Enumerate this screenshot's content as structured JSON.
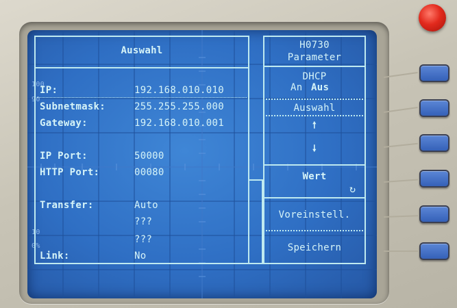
{
  "left_panel": {
    "title": "Auswahl",
    "rows": [
      {
        "label": "IP:",
        "value": "192.168.010.010"
      },
      {
        "label": "Subnetmask:",
        "value": "255.255.255.000"
      },
      {
        "label": "Gateway:",
        "value": "192.168.010.001"
      },
      {
        "label": "IP Port:",
        "value": "50000"
      },
      {
        "label": "HTTP Port:",
        "value": "00080"
      },
      {
        "label": "Transfer:",
        "value": "Auto"
      },
      {
        "label": "",
        "value": "???"
      },
      {
        "label": "",
        "value": "???"
      },
      {
        "label": "Link:",
        "value": "No"
      }
    ]
  },
  "right_panel": {
    "model": "H0730",
    "heading": "Parameter",
    "dhcp_label": "DHCP",
    "dhcp_on": "An",
    "dhcp_off": "Aus",
    "auswahl": "Auswahl",
    "up_arrow": "🠕",
    "down_arrow": "🠗",
    "wert": "Wert",
    "refresh_icon_glyph": "↻",
    "voreinstell": "Voreinstell.",
    "speichern": "Speichern"
  },
  "graticule_marks": {
    "top_100": "100",
    "top_90": "90",
    "bottom_10": "10",
    "bottom_0": "0%"
  },
  "colors": {
    "screen": "#2f6fc4",
    "text": "#d6f4f8",
    "softkey": "#3561b8",
    "power_button": "#e22a1d"
  }
}
